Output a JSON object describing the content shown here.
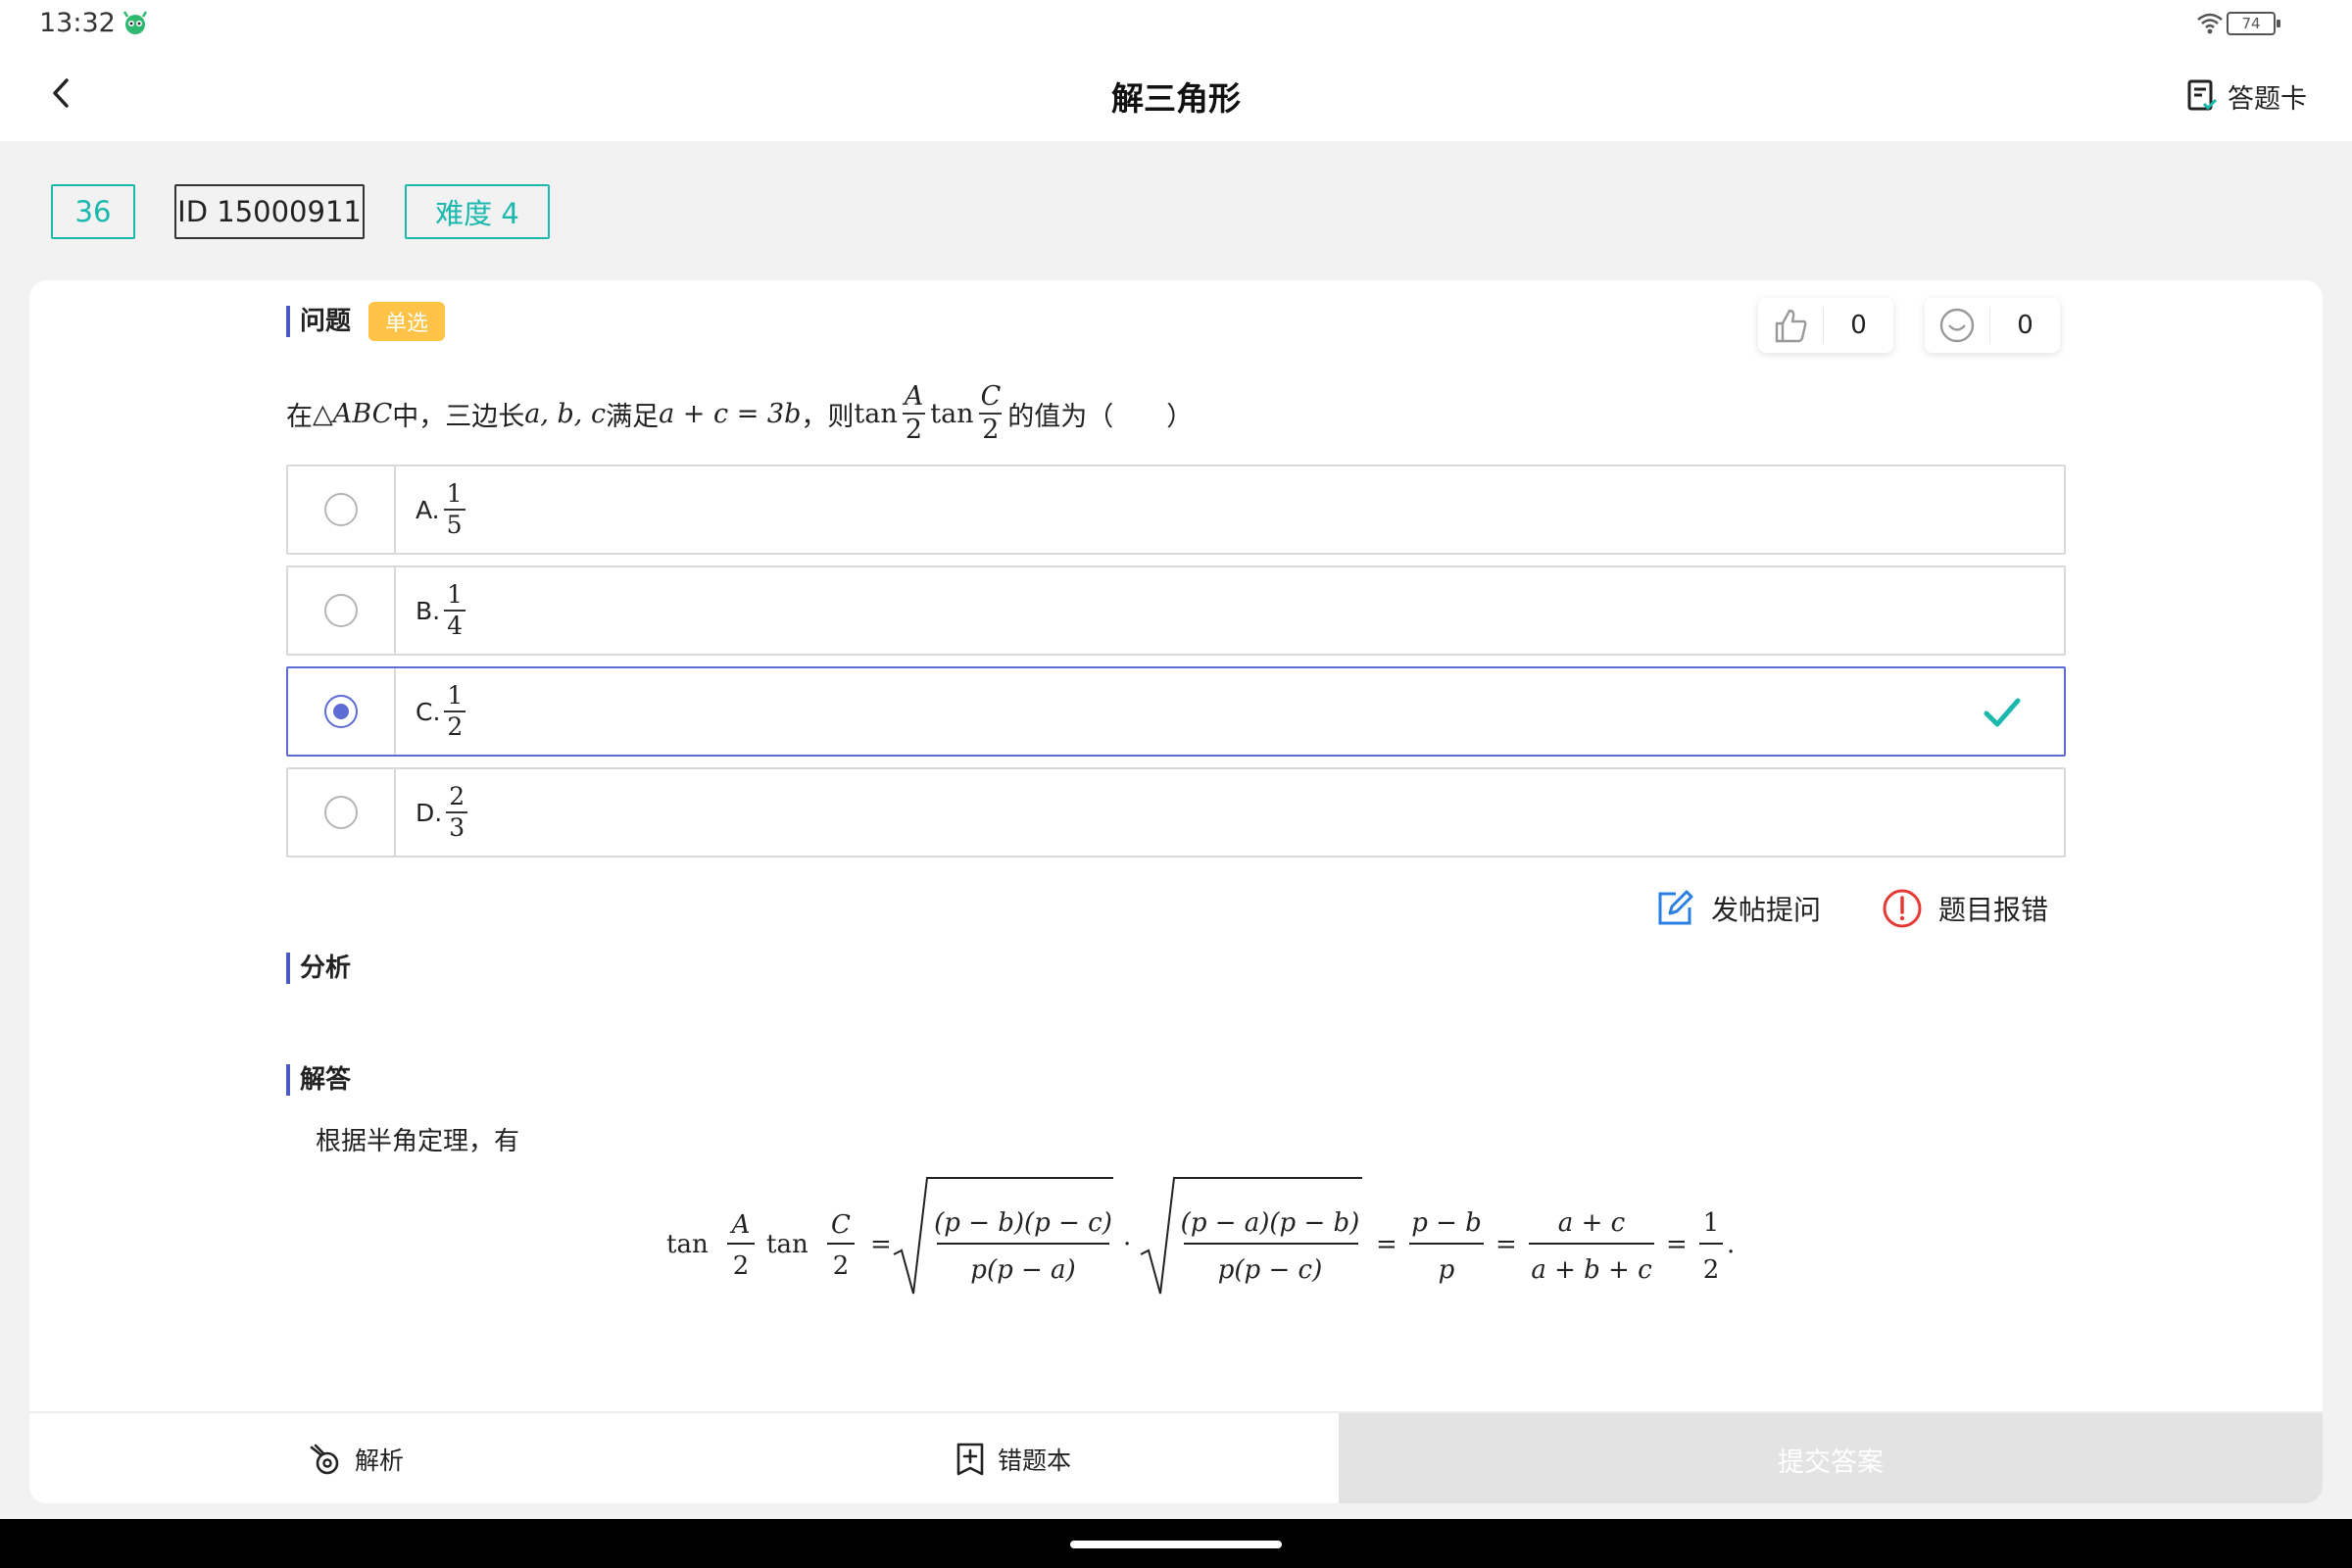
{
  "status": {
    "time": "13:32",
    "battery": "74"
  },
  "header": {
    "title": "解三角形",
    "answer_card": "答题卡"
  },
  "tags": {
    "number": "36",
    "id": "ID 15000911",
    "difficulty": "难度 4"
  },
  "question": {
    "section_label": "问题",
    "type_badge": "单选",
    "likes": "0",
    "reactions": "0",
    "text_prefix": "在 ",
    "triangle": "△ABC",
    "text_mid1": " 中，三边长 ",
    "sides": "a, b, c",
    "text_mid2": " 满足 ",
    "condition": "a + c = 3b",
    "text_mid3": "，则 ",
    "tan1": "tan",
    "frac1_num": "A",
    "frac1_den": "2",
    "tan2": "tan",
    "frac2_num": "C",
    "frac2_den": "2",
    "text_suffix": " 的值为（　　）"
  },
  "options": [
    {
      "letter": "A.",
      "num": "1",
      "den": "5",
      "selected": false
    },
    {
      "letter": "B.",
      "num": "1",
      "den": "4",
      "selected": false
    },
    {
      "letter": "C.",
      "num": "1",
      "den": "2",
      "selected": true
    },
    {
      "letter": "D.",
      "num": "2",
      "den": "3",
      "selected": false
    }
  ],
  "actions": {
    "post_question": "发帖提问",
    "report_error": "题目报错"
  },
  "analysis": {
    "label": "分析"
  },
  "solution": {
    "label": "解答",
    "intro": "根据半角定理，有",
    "formula": {
      "tan": "tan",
      "a_num": "A",
      "a_den": "2",
      "c_num": "C",
      "c_den": "2",
      "sqrt1_num": "(p − b)(p − c)",
      "sqrt1_den": "p(p − a)",
      "sqrt2_num": "(p − a)(p − b)",
      "sqrt2_den": "p(p − c)",
      "f3_num": "p − b",
      "f3_den": "p",
      "f4_num": "a + c",
      "f4_den": "a + b + c",
      "f5_num": "1",
      "f5_den": "2"
    }
  },
  "bottom": {
    "analysis": "解析",
    "wrong_book": "错题本",
    "submit": "提交答案"
  },
  "colors": {
    "accent": "#1ab8ad",
    "selected": "#5c6cd4",
    "badge": "#ffc348",
    "check": "#1ab8ad",
    "error": "#e53935",
    "edit": "#2a7fe0"
  }
}
